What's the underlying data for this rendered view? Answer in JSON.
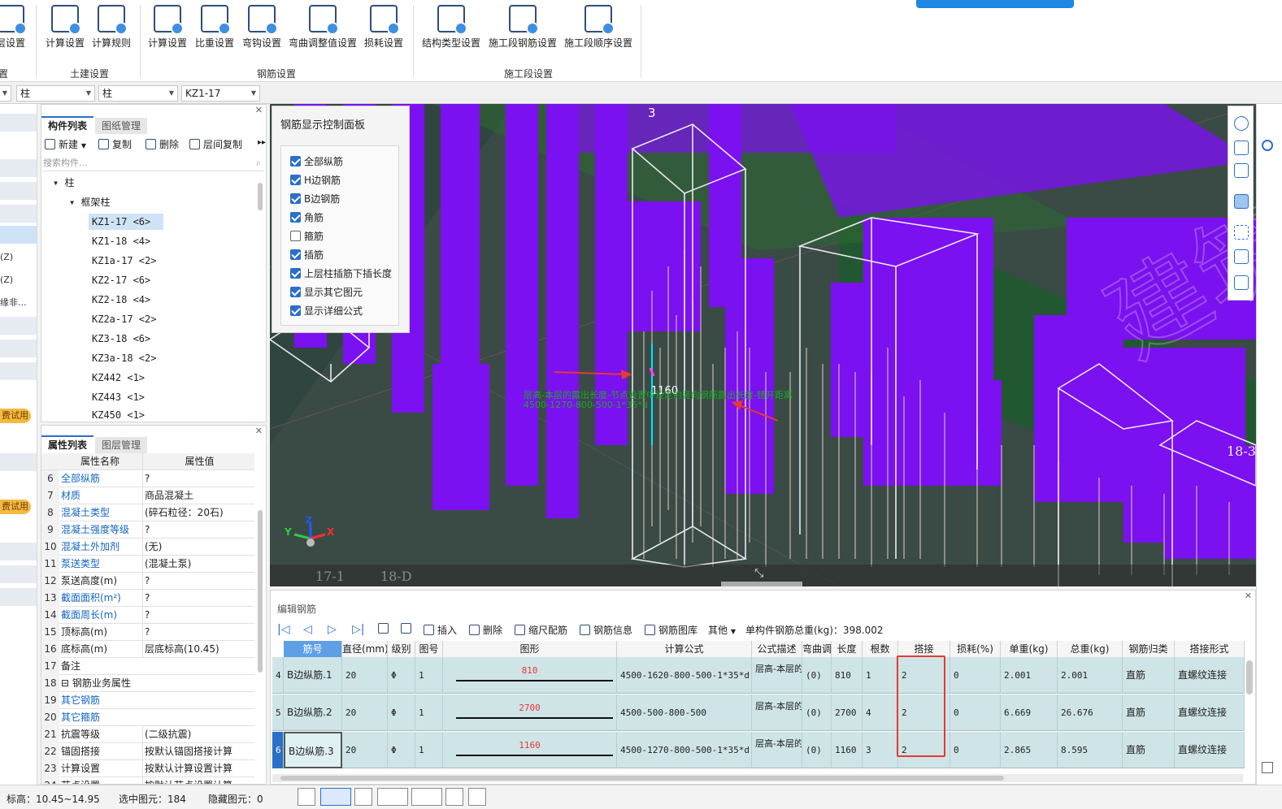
{
  "ribbon": {
    "buttons": [
      {
        "label": "层设置",
        "icon": "floor-settings-icon"
      },
      {
        "label": "计算设置",
        "icon": "calc-settings-icon"
      },
      {
        "label": "计算规则",
        "icon": "calc-rules-icon"
      },
      {
        "label": "计算设置",
        "icon": "rebar-calc-settings-icon"
      },
      {
        "label": "比重设置",
        "icon": "density-settings-icon"
      },
      {
        "label": "弯钩设置",
        "icon": "hook-settings-icon"
      },
      {
        "label": "弯曲调整值设置",
        "icon": "bend-adjust-icon"
      },
      {
        "label": "损耗设置",
        "icon": "loss-settings-icon"
      },
      {
        "label": "结构类型设置",
        "icon": "structure-type-icon"
      },
      {
        "label": "施工段钢筋设置",
        "icon": "segment-rebar-icon"
      },
      {
        "label": "施工段顺序设置",
        "icon": "segment-order-icon"
      }
    ],
    "groups": [
      "置",
      "土建设置",
      "钢筋设置",
      "施工段设置"
    ]
  },
  "selectors": [
    "",
    "柱",
    "柱",
    "KZ1-17"
  ],
  "left_strip": {
    "items": [
      "(Z)",
      "(Z)",
      "缘非..."
    ],
    "badges": [
      "费试用",
      "费试用"
    ]
  },
  "component_panel": {
    "tabs": [
      "构件列表",
      "图纸管理"
    ],
    "toolbar": [
      "新建",
      "复制",
      "删除",
      "层间复制"
    ],
    "search_placeholder": "搜索构件...",
    "tree_root": "柱",
    "tree_group": "框架柱",
    "items": [
      "KZ1-17 <6>",
      "KZ1-18 <4>",
      "KZ1a-17 <2>",
      "KZ2-17 <6>",
      "KZ2-18 <4>",
      "KZ2a-17 <2>",
      "KZ3-18 <6>",
      "KZ3a-18 <2>",
      "KZ442 <1>",
      "KZ443 <1>",
      "KZ450 <1>"
    ]
  },
  "property_panel": {
    "tabs": [
      "属性列表",
      "图层管理"
    ],
    "headers": [
      "属性名称",
      "属性值"
    ],
    "rows": [
      {
        "n": "6",
        "k": "全部纵筋",
        "v": "?",
        "blue": true
      },
      {
        "n": "7",
        "k": "材质",
        "v": "商品混凝土",
        "blue": true
      },
      {
        "n": "8",
        "k": "混凝土类型",
        "v": "(碎石粒径：20石)",
        "blue": true
      },
      {
        "n": "9",
        "k": "混凝土强度等级",
        "v": "?",
        "blue": true
      },
      {
        "n": "10",
        "k": "混凝土外加剂",
        "v": "(无)",
        "blue": true
      },
      {
        "n": "11",
        "k": "泵送类型",
        "v": "(混凝土泵)",
        "blue": true
      },
      {
        "n": "12",
        "k": "泵送高度(m)",
        "v": "?",
        "blue": false
      },
      {
        "n": "13",
        "k": "截面面积(m²)",
        "v": "?",
        "blue": true
      },
      {
        "n": "14",
        "k": "截面周长(m)",
        "v": "?",
        "blue": true
      },
      {
        "n": "15",
        "k": "顶标高(m)",
        "v": "?",
        "blue": false
      },
      {
        "n": "16",
        "k": "底标高(m)",
        "v": "层底标高(10.45)",
        "blue": false
      },
      {
        "n": "17",
        "k": "备注",
        "v": "",
        "blue": false
      },
      {
        "n": "18",
        "k": "⊟ 钢筋业务属性",
        "v": "",
        "blue": false
      },
      {
        "n": "19",
        "k": "    其它钢筋",
        "v": "",
        "blue": true
      },
      {
        "n": "20",
        "k": "    其它箍筋",
        "v": "",
        "blue": true
      },
      {
        "n": "21",
        "k": "    抗震等级",
        "v": "(二级抗震)",
        "blue": false
      },
      {
        "n": "22",
        "k": "    锚固搭接",
        "v": "按默认锚固搭接计算",
        "blue": false
      },
      {
        "n": "23",
        "k": "    计算设置",
        "v": "按默认计算设置计算",
        "blue": false
      },
      {
        "n": "24",
        "k": "    节点设置",
        "v": "按默认节点设置计算",
        "blue": false
      }
    ]
  },
  "viewport": {
    "control_panel_title": "钢筋显示控制面板",
    "checkboxes": [
      {
        "label": "全部纵筋",
        "checked": true
      },
      {
        "label": "H边钢筋",
        "checked": true
      },
      {
        "label": "B边钢筋",
        "checked": true
      },
      {
        "label": "角筋",
        "checked": true
      },
      {
        "label": "箍筋",
        "checked": false
      },
      {
        "label": "插筋",
        "checked": true
      },
      {
        "label": "上层柱插筋下插长度",
        "checked": true
      },
      {
        "label": "显示其它图元",
        "checked": true
      },
      {
        "label": "显示详细公式",
        "checked": true
      }
    ],
    "axis_labels": [
      "3",
      "17-1",
      "18-D",
      "18-3"
    ],
    "dimension": "1160",
    "annotation_line1": "层高-本层的露出长度-节点设置中设定的竖向钢筋露出长度-错开距离",
    "annotation_line2": "4500-1270-800-500-1*35*d",
    "axes": {
      "x": "X",
      "y": "Y",
      "z": "Z"
    },
    "watermark": "建筑"
  },
  "editor": {
    "title": "编辑钢筋",
    "toolbar": [
      "插入",
      "删除",
      "缩尺配筋",
      "钢筋信息",
      "钢筋图库",
      "其他"
    ],
    "total_weight": "单构件钢筋总重(kg)：398.002",
    "columns": [
      "筋号",
      "直径(mm)",
      "级别",
      "图号",
      "图形",
      "计算公式",
      "公式描述",
      "弯曲调整",
      "长度",
      "根数",
      "搭接",
      "损耗(%)",
      "单重(kg)",
      "总重(kg)",
      "钢筋归类",
      "搭接形式"
    ],
    "rows": [
      {
        "idx": "4",
        "name": "B边纵筋.1",
        "dia": "20",
        "grade": "Φ",
        "fig": "1",
        "shape": "810",
        "formula": "4500-1620-800-500-1*35*d",
        "desc": "层高-本层的露出...",
        "bend": "(0)",
        "len": "810",
        "count": "1",
        "lap": "2",
        "loss": "0",
        "unit": "2.001",
        "total": "2.001",
        "cat": "直筋",
        "lapform": "直螺纹连接"
      },
      {
        "idx": "5",
        "name": "B边纵筋.2",
        "dia": "20",
        "grade": "Φ",
        "fig": "1",
        "shape": "2700",
        "formula": "4500-500-800-500",
        "desc": "层高-本层的露出...",
        "bend": "(0)",
        "len": "2700",
        "count": "4",
        "lap": "2",
        "loss": "0",
        "unit": "6.669",
        "total": "26.676",
        "cat": "直筋",
        "lapform": "直螺纹连接"
      },
      {
        "idx": "6",
        "name": "B边纵筋.3",
        "dia": "20",
        "grade": "Φ",
        "fig": "1",
        "shape": "1160",
        "formula": "4500-1270-800-500-1*35*d",
        "desc": "层高-本层的露出...",
        "bend": "(0)",
        "len": "1160",
        "count": "3",
        "lap": "2",
        "loss": "0",
        "unit": "2.865",
        "total": "8.595",
        "cat": "直筋",
        "lapform": "直螺纹连接"
      }
    ]
  },
  "status": {
    "elevation": "标高：10.45~14.95",
    "selected": "选中图元：184",
    "hidden": "隐藏图元：0"
  },
  "colors": {
    "accent": "#2a6fc9",
    "viewport_bg": "#314540",
    "column_purple": "#7b10f0",
    "highlight_red": "#e53935",
    "row_bg": "#cfe4e6"
  }
}
